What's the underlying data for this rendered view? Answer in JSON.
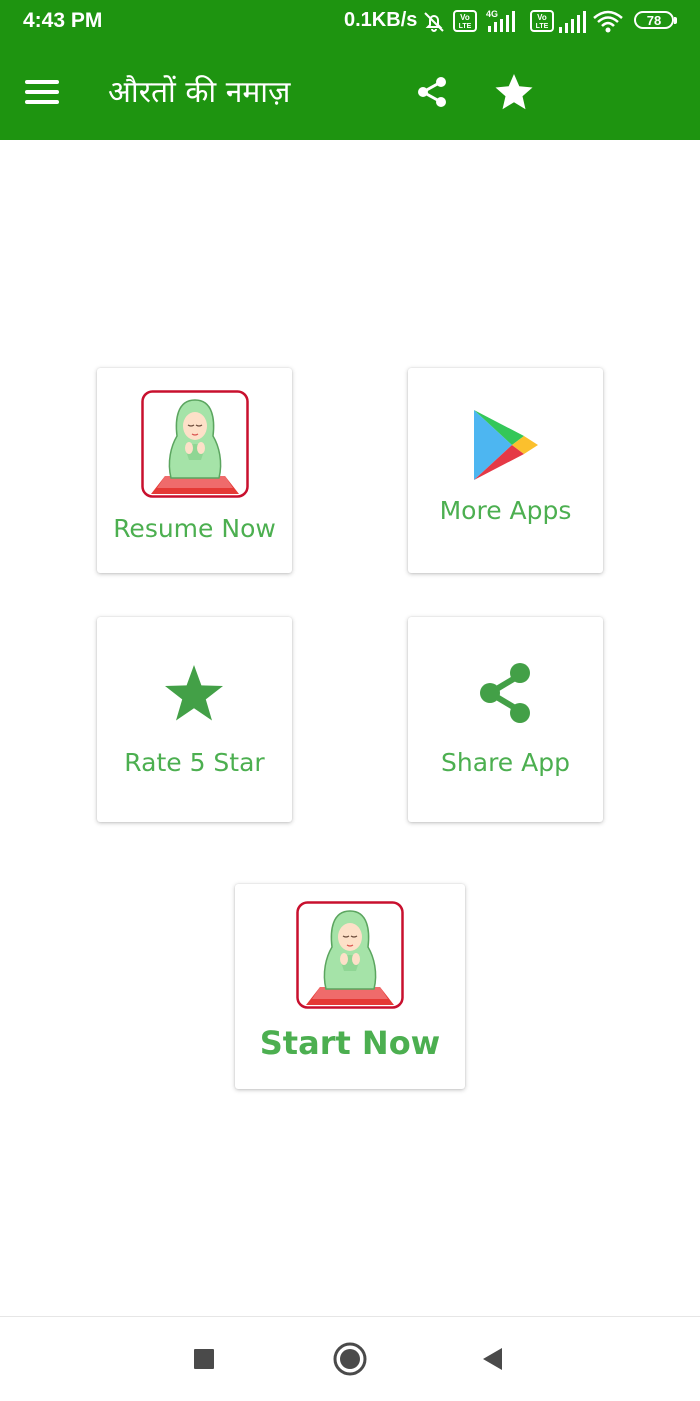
{
  "status_bar": {
    "time": "4:43 PM",
    "network_speed": "0.1KB/s",
    "battery": "78",
    "icons": [
      "mute-icon",
      "volte-icon",
      "signal-4g-icon",
      "volte-icon",
      "signal-icon",
      "wifi-icon",
      "battery-icon"
    ]
  },
  "toolbar": {
    "title": "औरतों की नमाज़",
    "menu_icon": "hamburger-menu-icon",
    "actions": [
      "share-icon",
      "star-icon"
    ]
  },
  "cards": {
    "resume": {
      "label": "Resume Now",
      "icon": "praying-woman-icon"
    },
    "more_apps": {
      "label": "More Apps",
      "icon": "play-store-icon"
    },
    "rate": {
      "label": "Rate 5 Star",
      "icon": "star-icon"
    },
    "share": {
      "label": "Share App",
      "icon": "share-icon"
    },
    "start": {
      "label": "Start Now",
      "icon": "praying-woman-icon"
    }
  },
  "nav_bar": {
    "buttons": [
      "recents-square-icon",
      "home-circle-icon",
      "back-triangle-icon"
    ]
  },
  "colors": {
    "primary": "#1e9410",
    "accent_text": "#4caf50",
    "icon_green": "#43a047",
    "frame_red": "#c8102e"
  }
}
